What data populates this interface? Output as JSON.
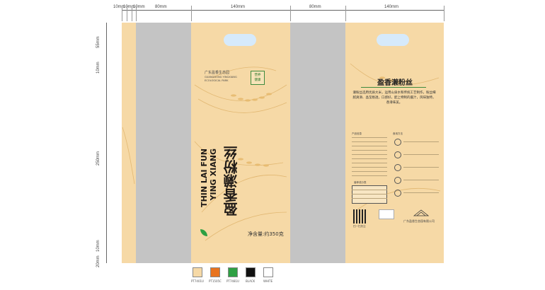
{
  "dimensions": {
    "top": [
      "10mm",
      "10mm",
      "10mm",
      "80mm",
      "140mm",
      "80mm",
      "140mm"
    ],
    "left": [
      "55mm",
      "10mm",
      "250mm",
      "10mm",
      "20mm"
    ]
  },
  "front": {
    "brand_cn": "广东盈香生态园",
    "brand_en_line1": "GUANGDONG YINGXIANG",
    "brand_en_line2": "ECOLOGICAL PARK",
    "badge": "营养\n健康",
    "title_cn": "盈香濑粉丝",
    "title_en_line1": "YING XIANG",
    "title_en_line2": "THIN LAI FUN",
    "net_weight": "净含量:约350克"
  },
  "back": {
    "title": "盈香濑粉丝",
    "intro": "濑粉丝选用优质大米，运用山泉水和传统工艺制作，粉丝细腻爽滑、晶莹剔透，口感好，配上特制的酱汁，风味独特，香滑味美。",
    "brand_foot": "广东盈香生态园有限公司",
    "qr_label": "扫一扫关注",
    "product_info_label": "产品信息",
    "nutrition_label": "营养成分表",
    "cook_label": "食用方法"
  },
  "swatches": [
    {
      "color": "#f6d9a6",
      "label": "PT7401U"
    },
    {
      "color": "#e8731e",
      "label": "PT1505C"
    },
    {
      "color": "#2ea043",
      "label": "PT7481U"
    },
    {
      "color": "#111111",
      "label": "BLACK"
    },
    {
      "color": "#ffffff",
      "label": "WHITE"
    }
  ]
}
